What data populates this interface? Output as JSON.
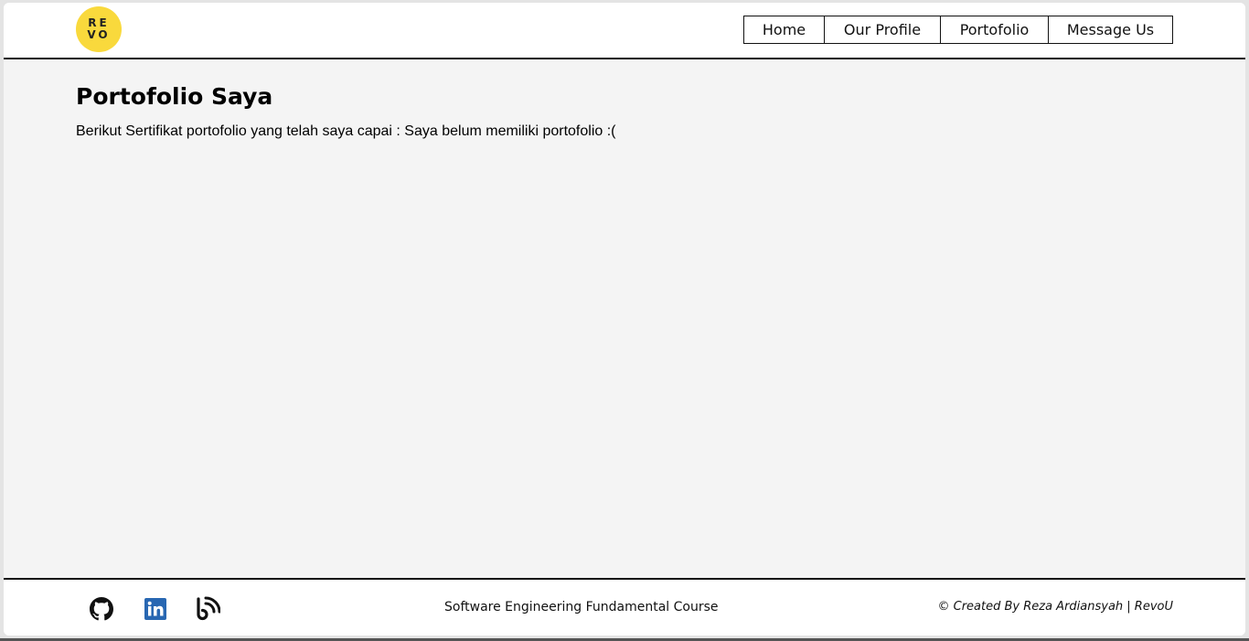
{
  "header": {
    "logo": {
      "line1": "RE",
      "line2": "VO"
    },
    "nav": [
      {
        "label": "Home"
      },
      {
        "label": "Our Profile"
      },
      {
        "label": "Portofolio"
      },
      {
        "label": "Message Us"
      }
    ]
  },
  "main": {
    "title": "Portofolio Saya",
    "description": "Berikut Sertifikat portofolio yang telah saya capai : Saya belum memiliki portofolio :("
  },
  "footer": {
    "social": [
      {
        "icon": "github-icon"
      },
      {
        "icon": "linkedin-icon",
        "color": "#2867b2"
      },
      {
        "icon": "blog-icon"
      }
    ],
    "course": "Software Engineering Fundamental Course",
    "credit": "© Created By Reza Ardiansyah | RevoU"
  },
  "colors": {
    "logo_bg": "#f9d93c",
    "main_bg": "#f4f4f4"
  }
}
